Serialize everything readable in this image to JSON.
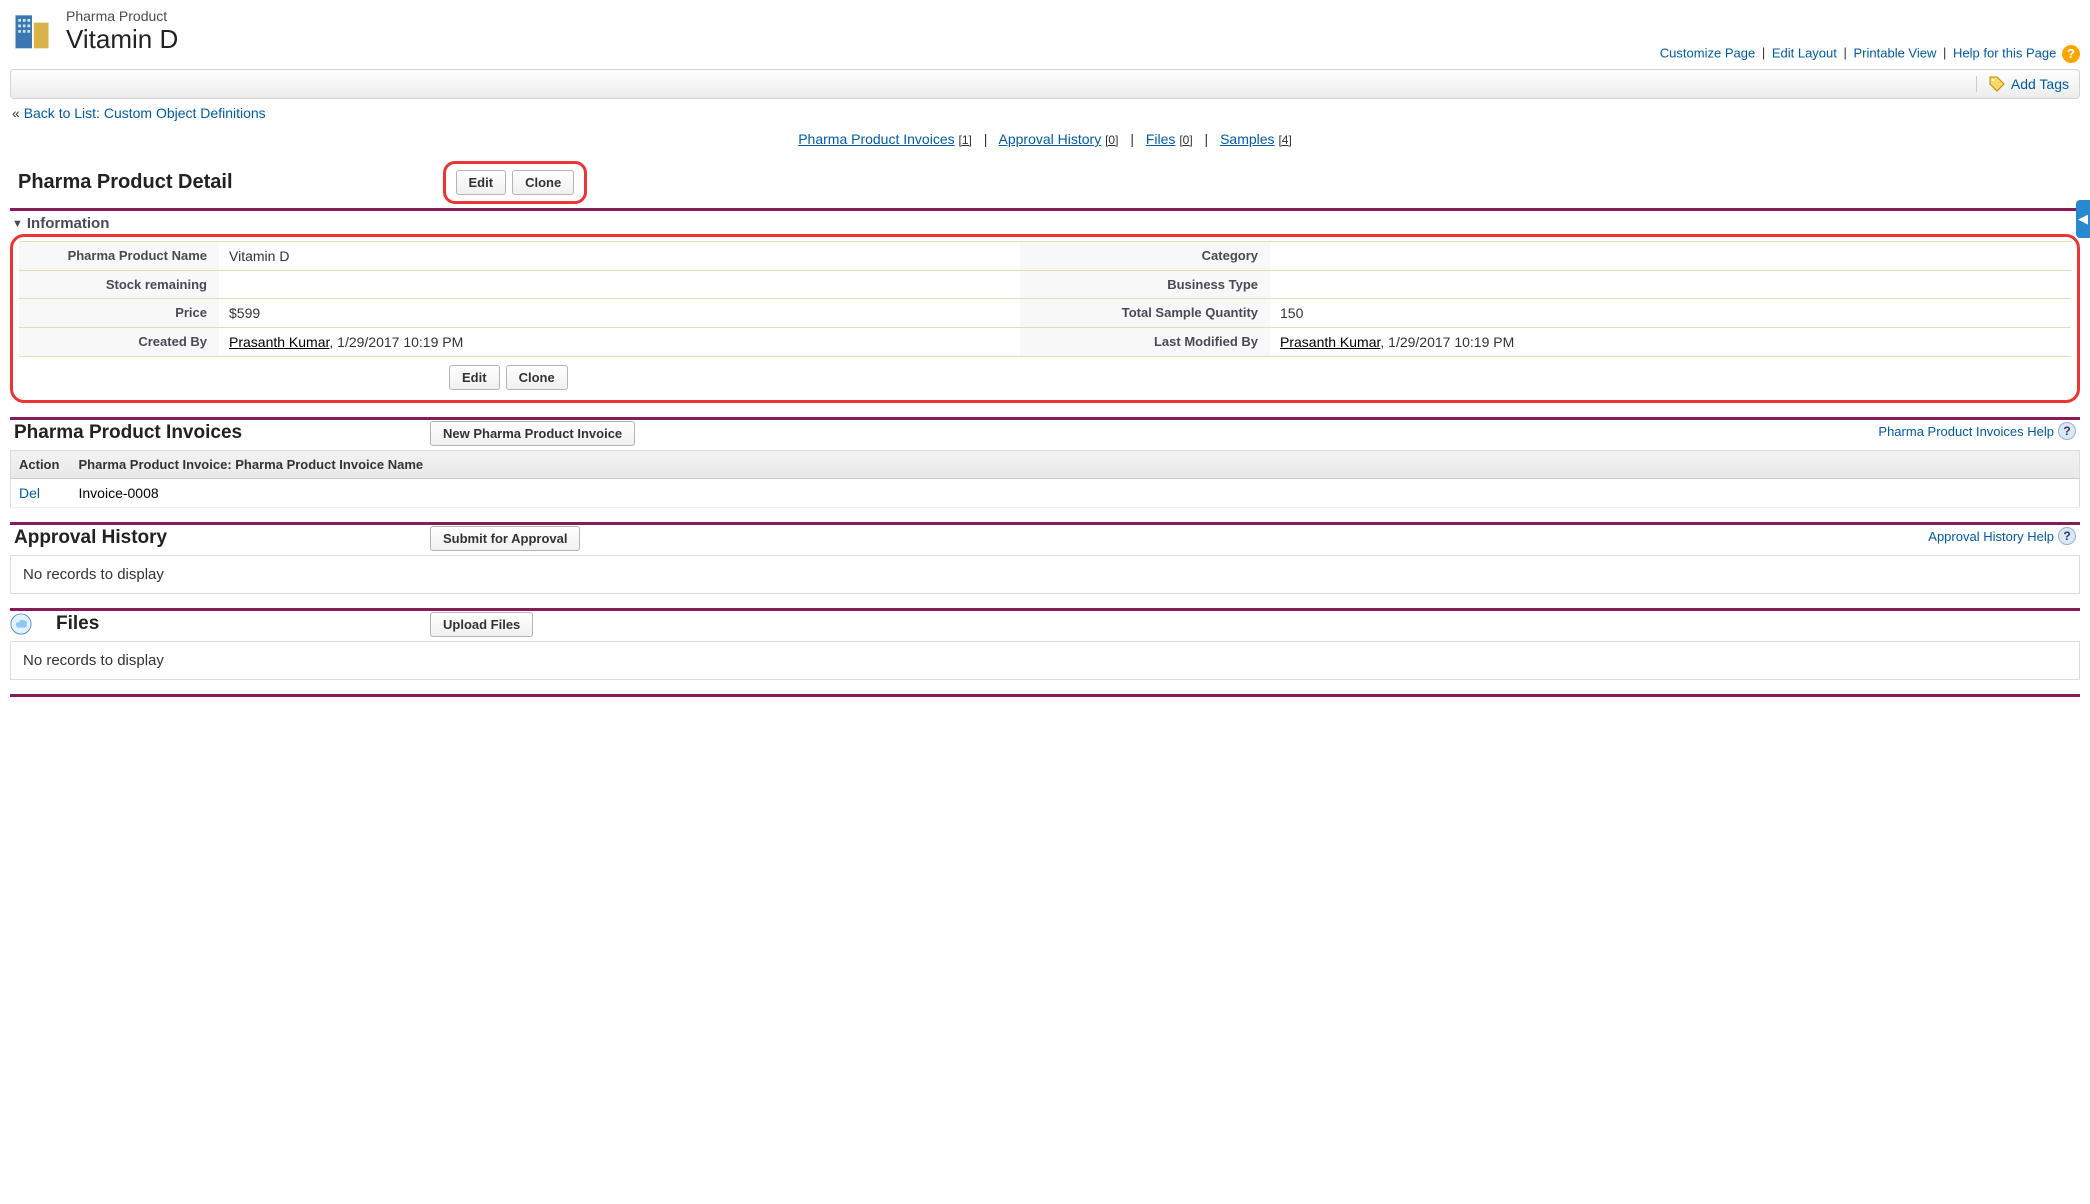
{
  "header": {
    "object_label": "Pharma Product",
    "title": "Vitamin D"
  },
  "top_links": {
    "customize": "Customize Page",
    "edit_layout": "Edit Layout",
    "printable": "Printable View",
    "help": "Help for this Page"
  },
  "toolbar": {
    "add_tags": "Add Tags"
  },
  "backlink": {
    "prefix": "« ",
    "text": "Back to List: Custom Object Definitions"
  },
  "related_links": {
    "items": [
      {
        "label": "Pharma Product Invoices",
        "count": "[1]"
      },
      {
        "label": "Approval History",
        "count": "[0]"
      },
      {
        "label": "Files",
        "count": "[0]"
      },
      {
        "label": "Samples",
        "count": "[4]"
      }
    ]
  },
  "detail": {
    "title": "Pharma Product Detail",
    "edit": "Edit",
    "clone": "Clone",
    "section_title": "Information",
    "fields": {
      "name_label": "Pharma Product Name",
      "name_value": "Vitamin D",
      "category_label": "Category",
      "category_value": "",
      "stock_label": "Stock remaining",
      "stock_value": "",
      "btype_label": "Business Type",
      "btype_value": "",
      "price_label": "Price",
      "price_value": "$599",
      "sample_label": "Total Sample Quantity",
      "sample_value": "150",
      "created_label": "Created By",
      "created_user": "Prasanth Kumar",
      "created_date": ", 1/29/2017 10:19 PM",
      "modified_label": "Last Modified By",
      "modified_user": "Prasanth Kumar",
      "modified_date": ", 1/29/2017 10:19 PM"
    }
  },
  "invoices": {
    "title": "Pharma Product Invoices",
    "button": "New Pharma Product Invoice",
    "help": "Pharma Product Invoices Help",
    "col_action": "Action",
    "col_name": "Pharma Product Invoice: Pharma Product Invoice Name",
    "row_action": "Del",
    "row_name": "Invoice-0008"
  },
  "approval": {
    "title": "Approval History",
    "button": "Submit for Approval",
    "help": "Approval History Help",
    "empty": "No records to display"
  },
  "files": {
    "title": "Files",
    "button": "Upload Files",
    "empty": "No records to display"
  }
}
